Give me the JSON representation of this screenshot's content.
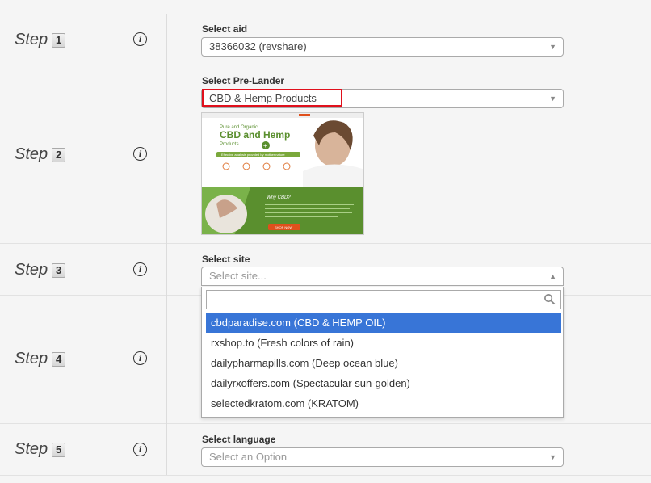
{
  "steps": [
    {
      "word": "Step",
      "num": "1"
    },
    {
      "word": "Step",
      "num": "2"
    },
    {
      "word": "Step",
      "num": "3"
    },
    {
      "word": "Step",
      "num": "4"
    },
    {
      "word": "Step",
      "num": "5"
    }
  ],
  "info_glyph": "i",
  "aid": {
    "label": "Select aid",
    "value": "38366032 (revshare)"
  },
  "prelander": {
    "label": "Select Pre-Lander",
    "value": "CBD & Hemp Products",
    "preview": {
      "line1": "Pure and Organic",
      "line2": "CBD and Hemp",
      "line3": "Products",
      "banner": "Effective analysis provided by mother nature",
      "why": "Why CBD?",
      "cta": "SHOP NOW"
    }
  },
  "site": {
    "label": "Select site",
    "placeholder": "Select site...",
    "search_value": "",
    "options": [
      {
        "text": "cbdparadise.com (CBD & HEMP OIL)",
        "selected": true
      },
      {
        "text": "rxshop.to (Fresh colors of rain)",
        "selected": false
      },
      {
        "text": "dailypharmapills.com (Deep ocean blue)",
        "selected": false
      },
      {
        "text": "dailyrxoffers.com (Spectacular sun-golden)",
        "selected": false
      },
      {
        "text": "selectedkratom.com (KRATOM)",
        "selected": false
      }
    ]
  },
  "language": {
    "label": "Select language",
    "placeholder": "Select an Option"
  },
  "colors": {
    "highlight": "#3875d7",
    "annotation": "#e0101c",
    "green": "#5a8f2e"
  }
}
